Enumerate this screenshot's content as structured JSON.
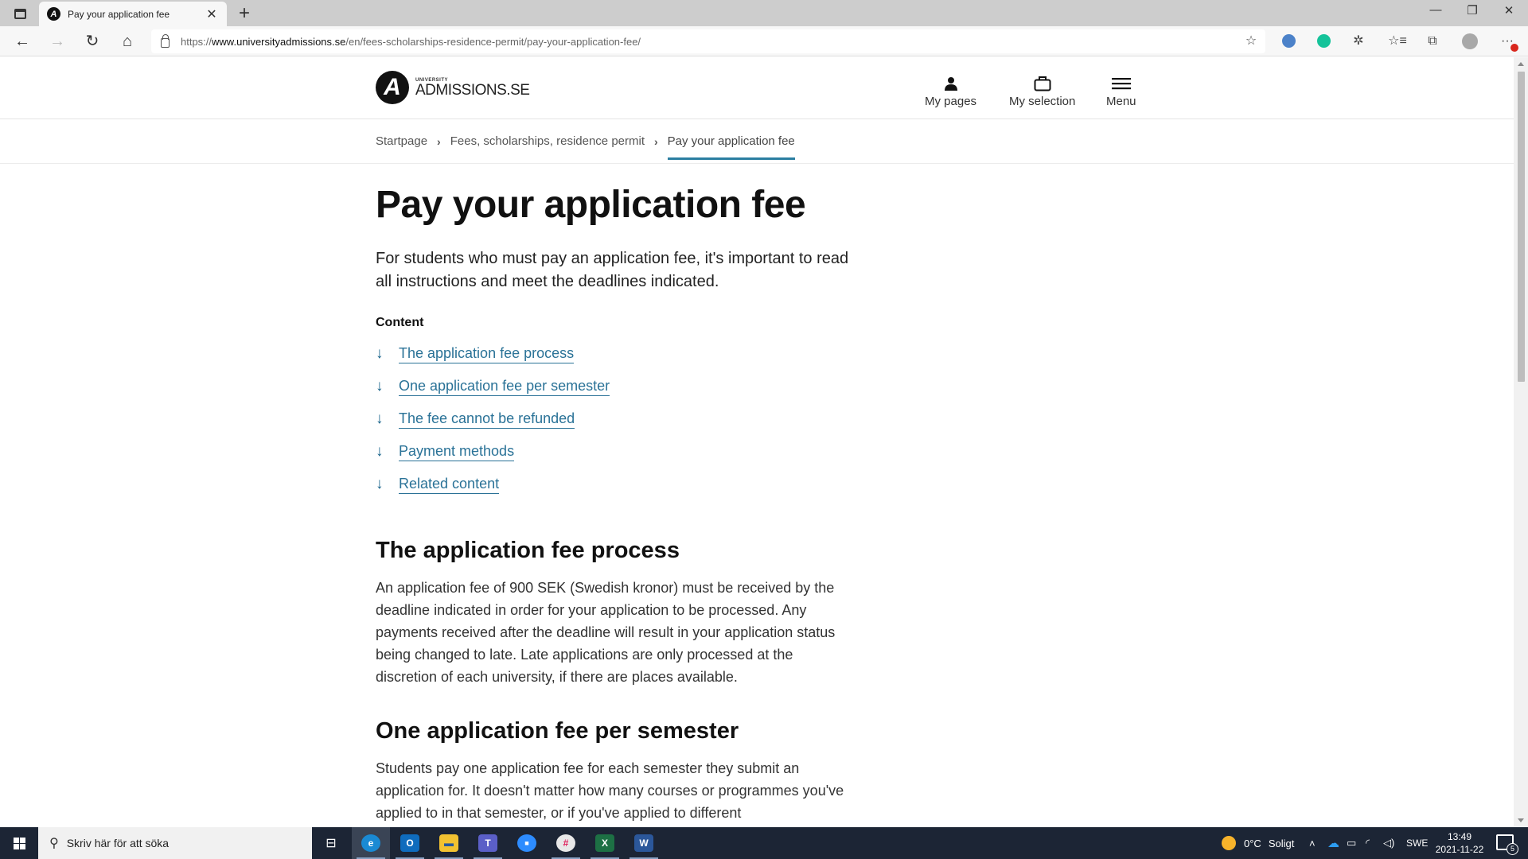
{
  "browser": {
    "tab_title": "Pay your application fee",
    "url_prefix": "https://",
    "url_host": "www.universityadmissions.se",
    "url_path": "/en/fees-scholarships-residence-permit/pay-your-application-fee/",
    "icons": {
      "tab_actions": "tab-actions-icon",
      "close_tab": "✕",
      "new_tab": "+",
      "back": "←",
      "forward": "→",
      "reload": "↻",
      "home": "⌂",
      "add_favorite": "☆",
      "favorites": "☆≡",
      "collections": "⧉",
      "more": "···",
      "minimize": "—",
      "restore": "❐",
      "close_window": "✕"
    },
    "extension_colors": {
      "ext1": "#4c82c9",
      "ext2": "#15c39a"
    }
  },
  "site": {
    "logo": {
      "mark": "A",
      "small": "UNIVERSITY",
      "big": "ADMISSIONS.SE"
    },
    "nav": [
      {
        "label": "My pages",
        "icon": "user-icon"
      },
      {
        "label": "My selection",
        "icon": "bag-icon"
      },
      {
        "label": "Menu",
        "icon": "menu-icon"
      }
    ],
    "breadcrumb": [
      {
        "label": "Startpage"
      },
      {
        "label": "Fees, scholarships, residence permit"
      },
      {
        "label": "Pay your application fee"
      }
    ],
    "accent_color": "#2b7ea1"
  },
  "article": {
    "title": "Pay your application fee",
    "lead": "For students who must pay an application fee, it's important to read all instructions and meet the deadlines indicated.",
    "toc_heading": "Content",
    "toc": [
      {
        "label": "The application fee process"
      },
      {
        "label": "One application fee per semester"
      },
      {
        "label": "The fee cannot be refunded"
      },
      {
        "label": "Payment methods"
      },
      {
        "label": "Related content"
      }
    ],
    "sections": [
      {
        "heading": "The application fee process",
        "body": "An application fee of 900 SEK (Swedish kronor) must be received by the deadline indicated in order for your application to be processed. Any payments received after the deadline will result in your application status being changed to late. Late applications are only processed at the discretion of each university, if there are places available."
      },
      {
        "heading": "One application fee per semester",
        "body": "Students pay one application fee for each semester they submit an application for. It doesn't matter how many courses or programmes you've applied to in that semester, or if you've applied to different"
      }
    ]
  },
  "taskbar": {
    "search_placeholder": "Skriv här för att söka",
    "apps": [
      {
        "name": "task-view",
        "glyph": "⊟"
      },
      {
        "name": "edge",
        "glyph": "e",
        "color": "#1a8ad4",
        "active": true
      },
      {
        "name": "outlook",
        "glyph": "O",
        "color": "#0f6cbd"
      },
      {
        "name": "file-explorer",
        "glyph": "▬",
        "color": "#f2c231"
      },
      {
        "name": "teams",
        "glyph": "T",
        "color": "#5b5fc7"
      },
      {
        "name": "zoom",
        "glyph": "■",
        "color": "#2d8cff"
      },
      {
        "name": "slack",
        "glyph": "#",
        "color": "#e8e8e8"
      },
      {
        "name": "excel",
        "glyph": "X",
        "color": "#1d7044"
      },
      {
        "name": "word",
        "glyph": "W",
        "color": "#2b579a"
      }
    ],
    "weather_temp": "0°C",
    "weather_text": "Soligt",
    "language": "SWE",
    "time": "13:49",
    "date": "2021-11-22",
    "notification_count": "5"
  }
}
